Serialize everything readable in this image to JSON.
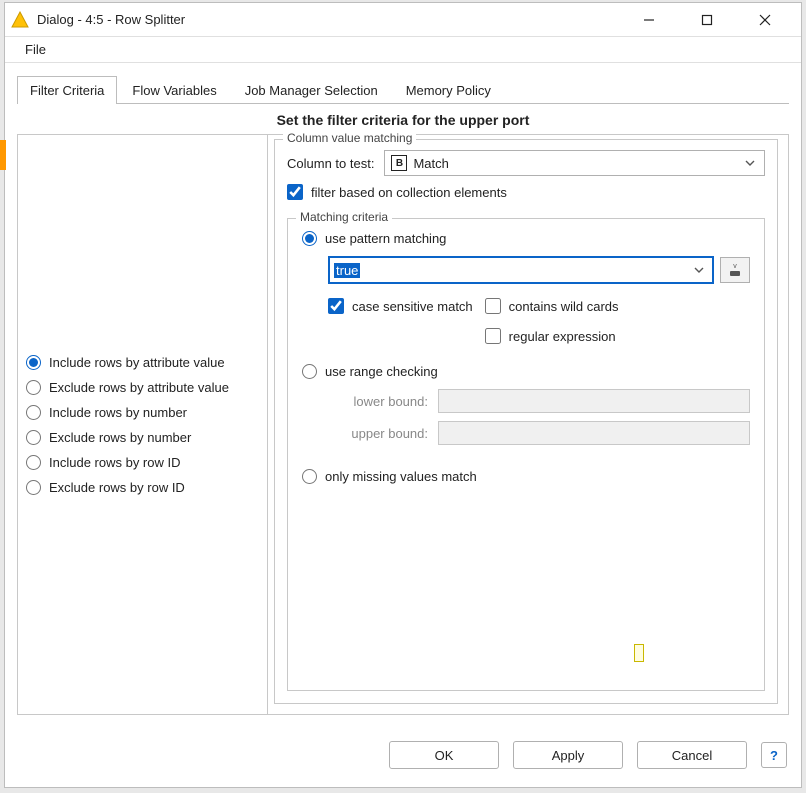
{
  "window": {
    "title": "Dialog - 4:5 - Row Splitter"
  },
  "menu": {
    "file": "File"
  },
  "tabs": {
    "filter_criteria": "Filter Criteria",
    "flow_variables": "Flow Variables",
    "job_manager": "Job Manager Selection",
    "memory_policy": "Memory Policy"
  },
  "panel": {
    "heading": "Set the filter criteria for the upper port"
  },
  "left_radios": {
    "include_attr": "Include rows by attribute value",
    "exclude_attr": "Exclude rows by attribute value",
    "include_num": "Include rows by number",
    "exclude_num": "Exclude rows by number",
    "include_rowid": "Include rows by row ID",
    "exclude_rowid": "Exclude rows by row ID"
  },
  "col_matching": {
    "legend": "Column value matching",
    "column_label": "Column to test:",
    "column_badge": "B",
    "column_value": "Match",
    "filter_collection_label": "filter based on collection elements"
  },
  "matching": {
    "legend": "Matching criteria",
    "pattern_radio": "use pattern matching",
    "pattern_value": "true",
    "case_sensitive": "case sensitive match",
    "wild_cards": "contains wild cards",
    "regex": "regular expression",
    "range_radio": "use range checking",
    "lower_label": "lower bound:",
    "upper_label": "upper bound:",
    "missing_radio": "only missing values match"
  },
  "buttons": {
    "ok": "OK",
    "apply": "Apply",
    "cancel": "Cancel",
    "help": "?"
  }
}
